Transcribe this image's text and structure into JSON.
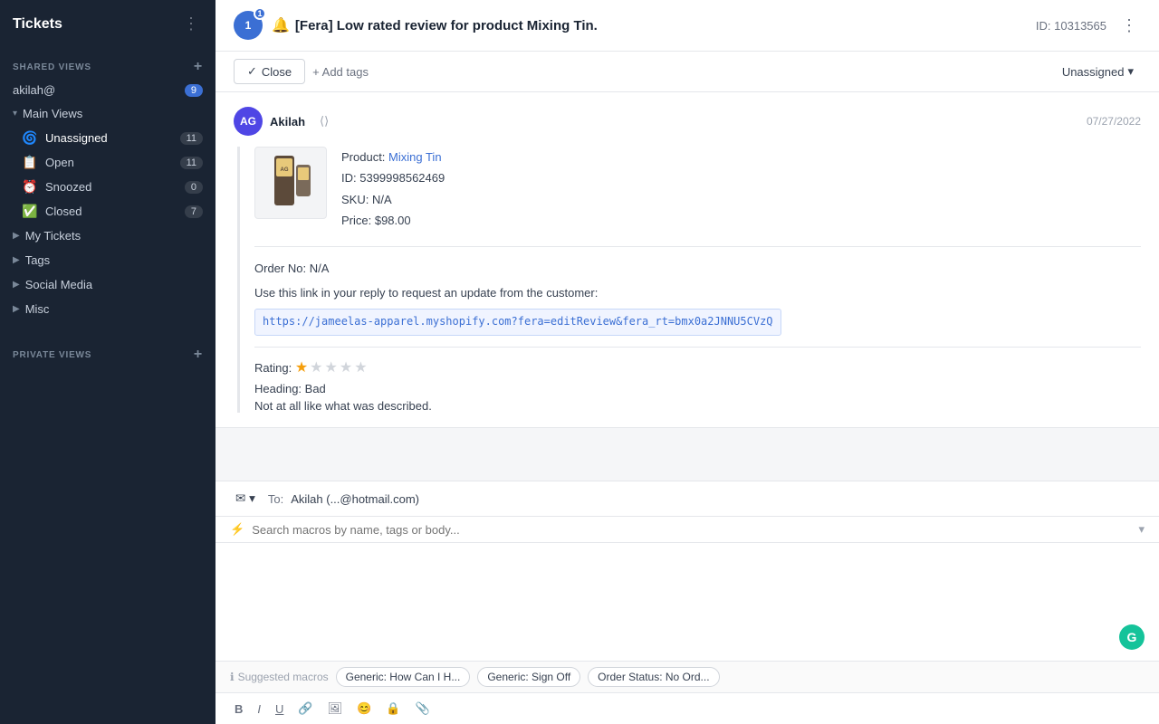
{
  "sidebar": {
    "app_title": "Tickets",
    "shared_views_label": "SHARED VIEWS",
    "private_views_label": "PRIVATE VIEWS",
    "email_item": {
      "label": "akilah@",
      "count": 9
    },
    "main_views_label": "Main Views",
    "views": [
      {
        "id": "unassigned",
        "icon": "🌀",
        "label": "Unassigned",
        "count": 11
      },
      {
        "id": "open",
        "icon": "📋",
        "label": "Open",
        "count": 11
      },
      {
        "id": "snoozed",
        "icon": "⏰",
        "label": "Snoozed",
        "count": 0
      },
      {
        "id": "closed",
        "icon": "✅",
        "label": "Closed",
        "count": 7
      }
    ],
    "my_tickets_label": "My Tickets",
    "tags_label": "Tags",
    "social_media_label": "Social Media",
    "misc_label": "Misc"
  },
  "ticket": {
    "id": "10313565",
    "title": "[Fera] Low rated review for product Mixing Tin.",
    "fire_emoji": "🔔",
    "assignee": "Unassigned",
    "close_btn": "Close",
    "add_tags_btn": "+ Add tags",
    "id_label": "ID: 10313565"
  },
  "message": {
    "sender_initials": "AG",
    "sender_name": "Akilah",
    "sender_handle": "",
    "date": "07/27/2022",
    "product": {
      "name": "Mixing Tin",
      "label_product": "Product:",
      "label_id": "ID:",
      "product_id": "5399998562469",
      "label_sku": "SKU:",
      "sku": "N/A",
      "label_price": "Price:",
      "price": "$98.00"
    },
    "order_no_label": "Order No:",
    "order_no": "N/A",
    "order_link_text": "Use this link in your reply to request an update from the customer:",
    "order_url": "https://jameelas-apparel.myshopify.com?fera=editReview&fera_rt=bmx0a2JNNU5CVzQ",
    "rating_label": "Rating:",
    "rating_value": 1,
    "rating_max": 5,
    "heading_label": "Heading:",
    "heading_value": "Bad",
    "review_body": "Not at all like what was described."
  },
  "composer": {
    "to_label": "To:",
    "to_email": "Akilah (...@hotmail.com)",
    "macro_placeholder": "Search macros by name, tags or body...",
    "suggested_label": "Suggested macros",
    "macros": [
      "Generic: How Can I H...",
      "Generic: Sign Off",
      "Order Status: No Ord..."
    ],
    "toolbar": {
      "bold": "B",
      "italic": "I",
      "underline": "U",
      "link": "🔗",
      "image": "🖼",
      "emoji": "😊",
      "lock": "🔒",
      "attach": "📎"
    }
  }
}
